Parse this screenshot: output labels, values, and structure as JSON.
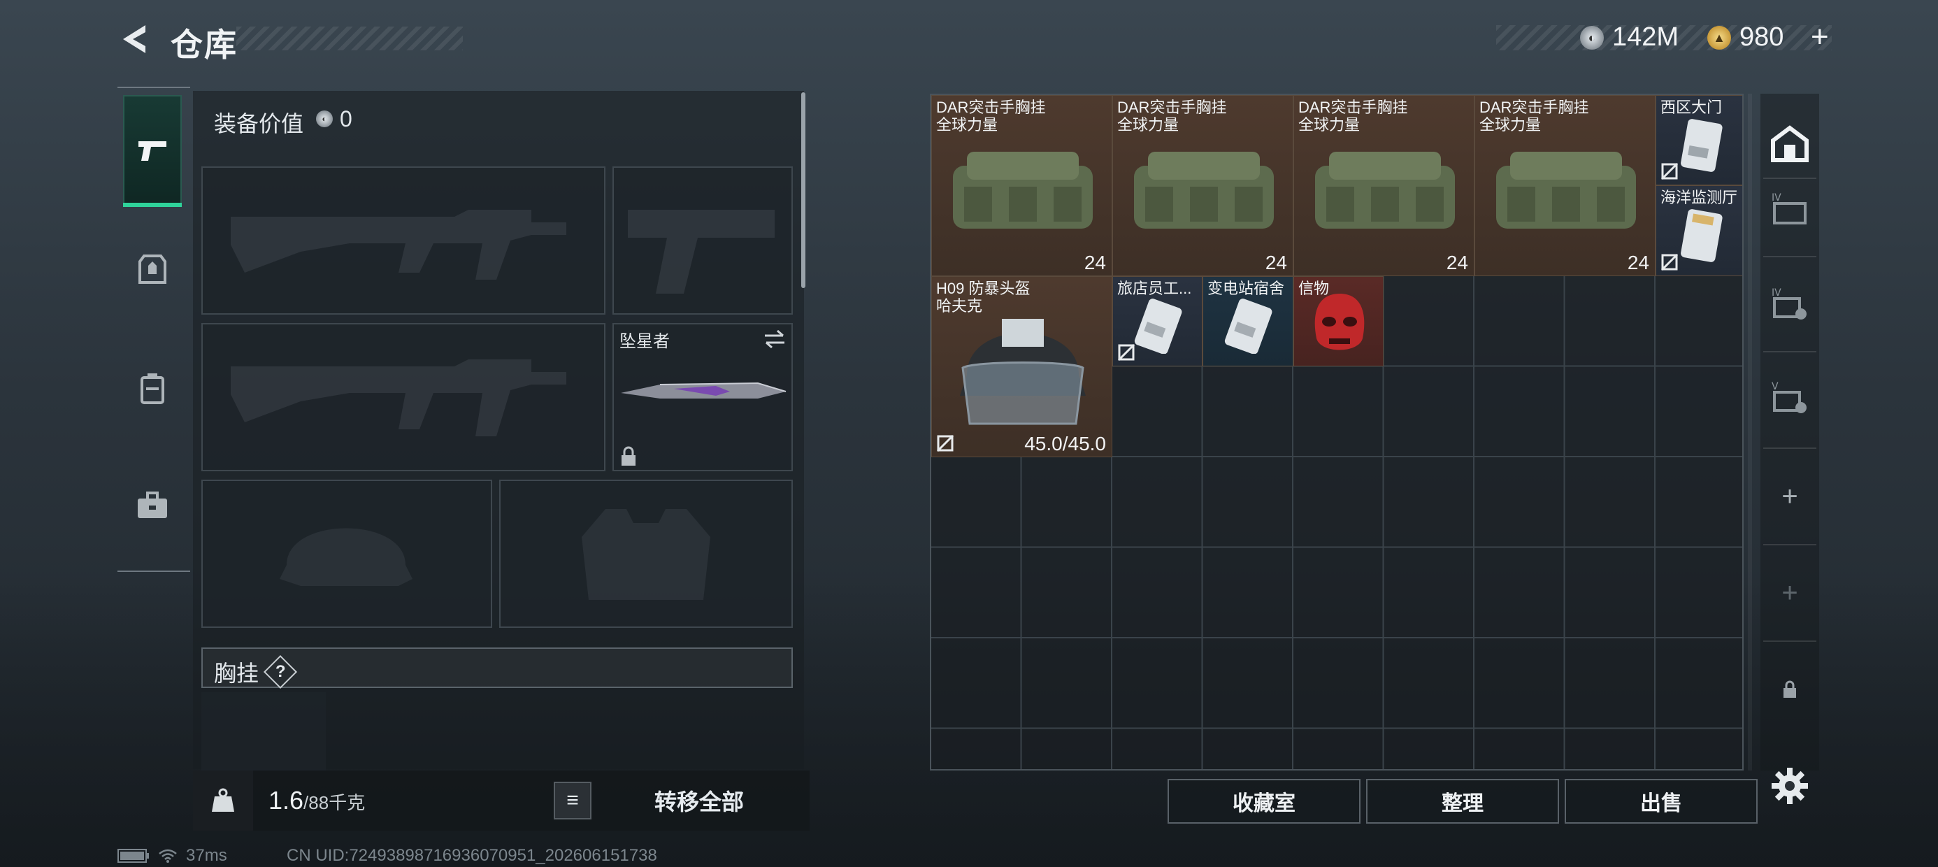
{
  "header": {
    "title": "仓库",
    "currency_silver": "142M",
    "currency_gold": "980"
  },
  "loadout": {
    "equipment_value_label": "装备价值",
    "equipment_value": "0",
    "melee_slot_name": "坠星者",
    "chest_rig_section": "胸挂",
    "help_glyph": "?"
  },
  "weight": {
    "current": "1.6",
    "capacity": "/88千克",
    "transfer_all": "转移全部"
  },
  "storage": {
    "items": [
      {
        "line1": "DAR突击手胸挂",
        "line2": "全球力量",
        "count": "24"
      },
      {
        "line1": "DAR突击手胸挂",
        "line2": "全球力量",
        "count": "24"
      },
      {
        "line1": "DAR突击手胸挂",
        "line2": "全球力量",
        "count": "24"
      },
      {
        "line1": "DAR突击手胸挂",
        "line2": "全球力量",
        "count": "24"
      },
      {
        "line1": "西区大门"
      },
      {
        "line1": "海洋监测厅"
      },
      {
        "line1": "H09 防暴头盔",
        "line2": "哈夫克",
        "durability": "45.0/45.0"
      },
      {
        "line1": "旅店员工..."
      },
      {
        "line1": "变电站宿舍"
      },
      {
        "line1": "信物"
      }
    ]
  },
  "actions": {
    "collection": "收藏室",
    "sort": "整理",
    "sell": "出售"
  },
  "status_bar": {
    "ping": "37ms",
    "uid": "CN UID:72493898716936070951_202606151738"
  },
  "colors": {
    "accent_green": "#2fd39a",
    "item_brown": "#4e3a2e",
    "item_blue": "#2a3240"
  }
}
